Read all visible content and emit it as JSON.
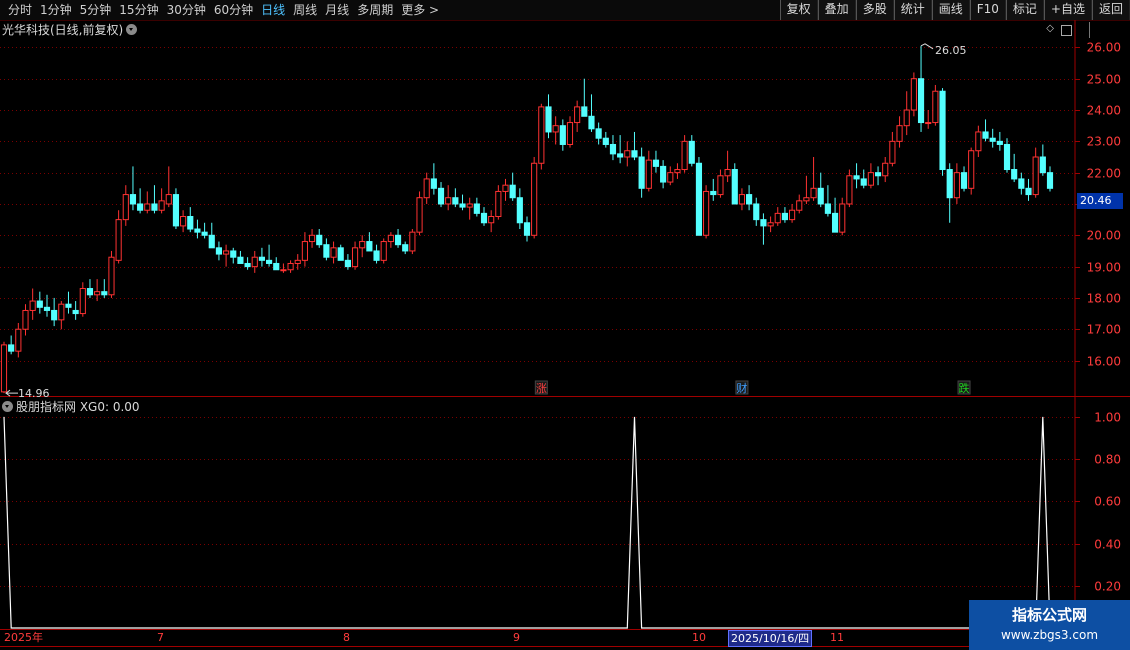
{
  "toolbar": {
    "tabs": [
      "分时",
      "1分钟",
      "5分钟",
      "15分钟",
      "30分钟",
      "60分钟",
      "日线",
      "周线",
      "月线",
      "多周期",
      "更多 >"
    ],
    "active_tab": "日线",
    "tools": [
      "复权",
      "叠加",
      "多股",
      "统计",
      "画线",
      "F10",
      "标记",
      "+自选",
      "返回"
    ]
  },
  "main_title": "光华科技(日线,前复权)",
  "sub_title": "股朋指标网 XG0: 0.00",
  "current_price": "20.46",
  "high_label": "26.05",
  "low_label": "14.96",
  "markers": [
    {
      "text": "涨",
      "color": "#ff4040"
    },
    {
      "text": "财",
      "color": "#40a0ff"
    },
    {
      "text": "跌",
      "color": "#20d020"
    }
  ],
  "date_axis": {
    "labels": [
      "2025年",
      "7",
      "8",
      "9",
      "10",
      "11"
    ],
    "selected": "2025/10/16/四"
  },
  "watermark": {
    "line1": "指标公式网",
    "line2": "www.zbgs3.com"
  },
  "chart_data": [
    {
      "type": "candlestick",
      "y_ticks": [
        16.0,
        17.0,
        18.0,
        19.0,
        20.0,
        21.0,
        22.0,
        23.0,
        24.0,
        25.0,
        26.0
      ],
      "ylim": [
        14.9,
        26.3
      ],
      "up_color": "#ff3232",
      "down_color": "#54ffff",
      "annotations": {
        "high": 26.05,
        "low": 14.96,
        "last": 20.46
      },
      "ohlc": [
        [
          15.0,
          16.6,
          14.96,
          16.5
        ],
        [
          16.5,
          16.8,
          16.2,
          16.3
        ],
        [
          16.3,
          17.2,
          16.1,
          17.0
        ],
        [
          17.0,
          17.8,
          16.8,
          17.6
        ],
        [
          17.6,
          18.3,
          17.3,
          17.9
        ],
        [
          17.9,
          18.2,
          17.5,
          17.7
        ],
        [
          17.7,
          18.1,
          17.4,
          17.6
        ],
        [
          17.6,
          18.0,
          17.1,
          17.3
        ],
        [
          17.3,
          17.9,
          17.0,
          17.8
        ],
        [
          17.8,
          18.2,
          17.5,
          17.7
        ],
        [
          17.6,
          17.9,
          17.3,
          17.5
        ],
        [
          17.5,
          18.5,
          17.4,
          18.3
        ],
        [
          18.3,
          18.6,
          18.0,
          18.1
        ],
        [
          18.1,
          18.6,
          17.9,
          18.2
        ],
        [
          18.2,
          18.6,
          18.0,
          18.1
        ],
        [
          18.1,
          19.5,
          18.0,
          19.3
        ],
        [
          19.2,
          20.8,
          19.1,
          20.5
        ],
        [
          20.5,
          21.6,
          20.3,
          21.3
        ],
        [
          21.3,
          22.2,
          20.8,
          21.0
        ],
        [
          21.0,
          21.5,
          20.7,
          20.8
        ],
        [
          20.8,
          21.4,
          20.7,
          21.0
        ],
        [
          21.0,
          21.6,
          20.7,
          20.8
        ],
        [
          20.8,
          21.5,
          20.7,
          21.1
        ],
        [
          21.0,
          22.2,
          20.9,
          21.3
        ],
        [
          21.3,
          21.5,
          20.2,
          20.3
        ],
        [
          20.3,
          20.8,
          20.1,
          20.6
        ],
        [
          20.6,
          20.9,
          20.1,
          20.2
        ],
        [
          20.2,
          20.5,
          19.9,
          20.1
        ],
        [
          20.1,
          20.4,
          19.9,
          20.0
        ],
        [
          20.0,
          20.4,
          19.6,
          19.6
        ],
        [
          19.6,
          19.8,
          19.2,
          19.4
        ],
        [
          19.4,
          19.7,
          19.0,
          19.5
        ],
        [
          19.5,
          19.6,
          19.1,
          19.3
        ],
        [
          19.3,
          19.5,
          19.1,
          19.1
        ],
        [
          19.1,
          19.3,
          18.9,
          19.0
        ],
        [
          19.0,
          19.5,
          18.8,
          19.3
        ],
        [
          19.3,
          19.6,
          19.0,
          19.2
        ],
        [
          19.2,
          19.7,
          19.0,
          19.1
        ],
        [
          19.1,
          19.3,
          18.9,
          18.9
        ],
        [
          18.9,
          19.1,
          18.8,
          18.9
        ],
        [
          18.9,
          19.2,
          18.8,
          19.1
        ],
        [
          19.1,
          19.4,
          18.9,
          19.2
        ],
        [
          19.2,
          20.1,
          19.0,
          19.8
        ],
        [
          19.8,
          20.2,
          19.6,
          20.0
        ],
        [
          20.0,
          20.2,
          19.6,
          19.7
        ],
        [
          19.7,
          19.9,
          19.2,
          19.3
        ],
        [
          19.3,
          19.8,
          19.1,
          19.6
        ],
        [
          19.6,
          19.7,
          19.2,
          19.2
        ],
        [
          19.2,
          19.4,
          18.9,
          19.0
        ],
        [
          19.0,
          19.8,
          18.9,
          19.6
        ],
        [
          19.6,
          20.0,
          19.3,
          19.8
        ],
        [
          19.8,
          20.1,
          19.5,
          19.5
        ],
        [
          19.5,
          19.7,
          19.1,
          19.2
        ],
        [
          19.2,
          19.9,
          19.1,
          19.8
        ],
        [
          19.8,
          20.1,
          19.6,
          20.0
        ],
        [
          20.0,
          20.2,
          19.6,
          19.7
        ],
        [
          19.7,
          19.8,
          19.4,
          19.5
        ],
        [
          19.5,
          20.2,
          19.4,
          20.1
        ],
        [
          20.1,
          21.4,
          20.0,
          21.2
        ],
        [
          21.2,
          22.0,
          21.0,
          21.8
        ],
        [
          21.8,
          22.3,
          21.3,
          21.5
        ],
        [
          21.5,
          21.7,
          20.9,
          21.0
        ],
        [
          21.0,
          21.6,
          20.8,
          21.2
        ],
        [
          21.2,
          21.5,
          20.9,
          21.0
        ],
        [
          21.0,
          21.3,
          20.8,
          20.9
        ],
        [
          20.9,
          21.2,
          20.5,
          21.0
        ],
        [
          21.0,
          21.2,
          20.6,
          20.7
        ],
        [
          20.7,
          20.9,
          20.3,
          20.4
        ],
        [
          20.4,
          20.8,
          20.1,
          20.6
        ],
        [
          20.6,
          21.6,
          20.5,
          21.4
        ],
        [
          21.4,
          21.8,
          21.1,
          21.6
        ],
        [
          21.6,
          22.0,
          21.1,
          21.2
        ],
        [
          21.2,
          21.5,
          20.2,
          20.4
        ],
        [
          20.4,
          20.6,
          19.8,
          20.0
        ],
        [
          20.0,
          22.5,
          19.9,
          22.3
        ],
        [
          22.3,
          24.2,
          22.1,
          24.1
        ],
        [
          24.1,
          24.5,
          23.1,
          23.3
        ],
        [
          23.3,
          23.8,
          22.9,
          23.5
        ],
        [
          23.5,
          23.7,
          22.7,
          22.9
        ],
        [
          22.9,
          23.8,
          22.8,
          23.6
        ],
        [
          23.6,
          24.3,
          23.3,
          24.1
        ],
        [
          24.1,
          25.0,
          23.8,
          23.8
        ],
        [
          23.8,
          24.5,
          23.3,
          23.4
        ],
        [
          23.4,
          23.6,
          22.9,
          23.1
        ],
        [
          23.1,
          23.3,
          22.8,
          22.9
        ],
        [
          22.9,
          23.2,
          22.4,
          22.6
        ],
        [
          22.6,
          23.2,
          22.3,
          22.5
        ],
        [
          22.5,
          23.0,
          22.2,
          22.7
        ],
        [
          22.7,
          23.3,
          22.4,
          22.5
        ],
        [
          22.5,
          22.8,
          21.2,
          21.5
        ],
        [
          21.5,
          22.7,
          21.4,
          22.4
        ],
        [
          22.4,
          22.7,
          22.0,
          22.2
        ],
        [
          22.2,
          22.4,
          21.5,
          21.7
        ],
        [
          21.7,
          22.2,
          21.6,
          22.0
        ],
        [
          22.0,
          22.3,
          21.8,
          22.1
        ],
        [
          22.1,
          23.2,
          22.0,
          23.0
        ],
        [
          23.0,
          23.2,
          22.2,
          22.3
        ],
        [
          22.3,
          22.5,
          20.0,
          20.0
        ],
        [
          20.0,
          21.6,
          19.9,
          21.4
        ],
        [
          21.4,
          21.8,
          21.1,
          21.3
        ],
        [
          21.3,
          22.1,
          21.2,
          21.9
        ],
        [
          21.9,
          22.7,
          21.7,
          22.1
        ],
        [
          22.1,
          22.3,
          21.0,
          21.0
        ],
        [
          21.0,
          21.5,
          20.8,
          21.3
        ],
        [
          21.3,
          21.6,
          20.8,
          21.0
        ],
        [
          21.0,
          21.2,
          20.3,
          20.5
        ],
        [
          20.5,
          20.7,
          19.7,
          20.3
        ],
        [
          20.3,
          20.6,
          20.1,
          20.4
        ],
        [
          20.4,
          20.9,
          20.3,
          20.7
        ],
        [
          20.7,
          20.9,
          20.4,
          20.5
        ],
        [
          20.5,
          21.0,
          20.4,
          20.8
        ],
        [
          20.8,
          21.3,
          20.7,
          21.1
        ],
        [
          21.1,
          21.9,
          21.0,
          21.2
        ],
        [
          21.2,
          22.5,
          21.1,
          21.5
        ],
        [
          21.5,
          22.0,
          20.9,
          21.0
        ],
        [
          21.0,
          21.6,
          20.6,
          20.7
        ],
        [
          20.7,
          21.2,
          20.2,
          20.1
        ],
        [
          20.1,
          21.2,
          20.0,
          21.0
        ],
        [
          21.0,
          22.1,
          20.9,
          21.9
        ],
        [
          21.9,
          22.3,
          21.5,
          21.8
        ],
        [
          21.8,
          22.1,
          21.5,
          21.6
        ],
        [
          21.6,
          22.3,
          21.5,
          22.0
        ],
        [
          22.0,
          22.2,
          21.6,
          21.9
        ],
        [
          21.9,
          22.5,
          21.7,
          22.3
        ],
        [
          22.3,
          23.3,
          22.2,
          23.0
        ],
        [
          23.0,
          23.8,
          22.8,
          23.5
        ],
        [
          23.5,
          24.6,
          23.2,
          24.0
        ],
        [
          24.0,
          25.2,
          23.8,
          25.0
        ],
        [
          25.0,
          26.05,
          23.3,
          23.6
        ],
        [
          23.6,
          24.0,
          23.4,
          23.6
        ],
        [
          23.6,
          24.8,
          23.5,
          24.6
        ],
        [
          24.6,
          24.7,
          21.9,
          22.1
        ],
        [
          22.1,
          22.3,
          20.4,
          21.2
        ],
        [
          21.2,
          22.3,
          21.0,
          22.0
        ],
        [
          22.0,
          22.2,
          21.4,
          21.5
        ],
        [
          21.5,
          22.8,
          21.3,
          22.7
        ],
        [
          22.7,
          23.5,
          22.5,
          23.3
        ],
        [
          23.3,
          23.7,
          23.0,
          23.1
        ],
        [
          23.1,
          23.4,
          22.8,
          23.0
        ],
        [
          23.0,
          23.3,
          22.7,
          22.9
        ],
        [
          22.9,
          23.1,
          22.0,
          22.1
        ],
        [
          22.1,
          22.6,
          21.7,
          21.8
        ],
        [
          21.8,
          22.0,
          21.3,
          21.5
        ],
        [
          21.5,
          21.8,
          21.1,
          21.3
        ],
        [
          21.3,
          22.8,
          21.2,
          22.5
        ],
        [
          22.5,
          22.9,
          21.9,
          22.0
        ],
        [
          22.0,
          22.2,
          21.4,
          21.5
        ]
      ]
    },
    {
      "type": "line",
      "name": "XG0",
      "y_ticks": [
        0.2,
        0.4,
        0.6,
        0.8,
        1.0
      ],
      "ylim": [
        0,
        1.08
      ],
      "values_nonzero_at": [
        0,
        88,
        145,
        155
      ],
      "value": 1.0
    }
  ]
}
